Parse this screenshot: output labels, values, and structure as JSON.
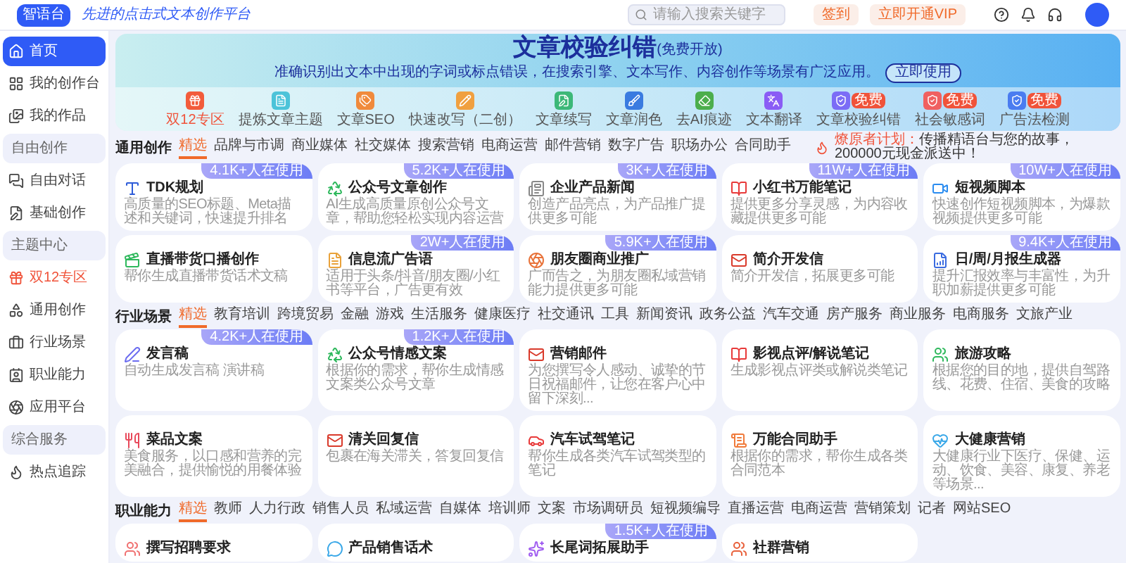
{
  "header": {
    "logo": "智语台",
    "slogan": "先进的点击式文本创作平台",
    "search": {
      "placeholder": "请输入搜索关键字"
    },
    "buttons": [
      {
        "label": "签到"
      },
      {
        "label": "立即开通VIP"
      }
    ]
  },
  "sidebar": {
    "items": [
      {
        "kind": "item",
        "label": "首页",
        "selected": true
      },
      {
        "kind": "item",
        "label": "我的创作台",
        "selected": false
      },
      {
        "kind": "item",
        "label": "我的作品",
        "selected": false
      },
      {
        "kind": "group",
        "label": "自由创作"
      },
      {
        "kind": "item",
        "label": "自由对话",
        "selected": false
      },
      {
        "kind": "item",
        "label": "基础创作",
        "selected": false
      },
      {
        "kind": "group",
        "label": "主题中心"
      },
      {
        "kind": "promo",
        "label": "双12专区",
        "selected": false
      },
      {
        "kind": "item",
        "label": "通用创作",
        "selected": false
      },
      {
        "kind": "item",
        "label": "行业场景",
        "selected": false
      },
      {
        "kind": "item",
        "label": "职业能力",
        "selected": false
      },
      {
        "kind": "item",
        "label": "应用平台",
        "selected": false
      },
      {
        "kind": "group",
        "label": "综合服务"
      },
      {
        "kind": "item",
        "label": "热点追踪",
        "selected": false
      }
    ]
  },
  "banner": {
    "title": "文章校验纠错",
    "title_note": "(免费开放)",
    "subtitle": "准确识别出文本中出现的字词或标点错误，在搜索引擎、文本写作、内容创作等场景有广泛应用。",
    "button": "立即使用",
    "tools": [
      {
        "label": "双12专区",
        "selected": true
      },
      {
        "label": "提炼文章主题",
        "selected": false
      },
      {
        "label": "文章SEO",
        "selected": false
      },
      {
        "label": "快速改写（二创）",
        "selected": false
      },
      {
        "label": "文章续写",
        "selected": false
      },
      {
        "label": "文章润色",
        "selected": false
      },
      {
        "label": "去AI痕迹",
        "selected": false
      },
      {
        "label": "文本翻译",
        "selected": false
      },
      {
        "label": "文章校验纠错",
        "selected": false,
        "badge": "免费"
      },
      {
        "label": "社会敏感词",
        "selected": false,
        "badge": "免费"
      },
      {
        "label": "广告法检测",
        "selected": false,
        "badge": "免费"
      }
    ]
  },
  "sections": [
    {
      "title": "通用创作",
      "tabs": [
        {
          "label": "精选",
          "selected": true
        },
        {
          "label": "品牌与市调",
          "selected": false
        },
        {
          "label": "商业媒体",
          "selected": false
        },
        {
          "label": "社交媒体",
          "selected": false
        },
        {
          "label": "搜索营销",
          "selected": false
        },
        {
          "label": "电商运营",
          "selected": false
        },
        {
          "label": "邮件营销",
          "selected": false
        },
        {
          "label": "数字广告",
          "selected": false
        },
        {
          "label": "职场办公",
          "selected": false
        },
        {
          "label": "合同助手",
          "selected": false
        }
      ],
      "notice": {
        "lead": "燎原者计划：",
        "text": "传播精语台与您的故事，200000元现金派送中！"
      },
      "cards": [
        {
          "title": "TDK规划",
          "description": "高质量的SEO标题、Meta描述和关键词，快速提升排名",
          "badge": "4.1K+人在使用"
        },
        {
          "title": "公众号文章创作",
          "description": "AI生成高质量原创公众号文章，帮助您轻松实现内容运营",
          "badge": "5.2K+人在使用"
        },
        {
          "title": "企业产品新闻",
          "description": "创造产品亮点，为产品推广提供更多可能",
          "badge": "3K+人在使用"
        },
        {
          "title": "小红书万能笔记",
          "description": "提供更多分享灵感，为内容收藏提供更多可能",
          "badge": "11W+人在使用"
        },
        {
          "title": "短视频脚本",
          "description": "快速创作短视频脚本，为爆款视频提供更多可能",
          "badge": "10W+人在使用"
        },
        {
          "title": "直播带货口播创作",
          "description": "帮你生成直播带货话术文稿"
        },
        {
          "title": "信息流广告语",
          "description": "适用于头条/抖音/朋友圈/小红书等平台，广告更有效",
          "badge": "2W+人在使用"
        },
        {
          "title": "朋友圈商业推广",
          "description": "广而告之，为朋友圈私域营销能力提供更多可能",
          "badge": "5.9K+人在使用"
        },
        {
          "title": "简介开发信",
          "description": "简介开发信，拓展更多可能"
        },
        {
          "title": "日/周/月报生成器",
          "description": "提升汇报效率与丰富性，为升职加薪提供更多可能",
          "badge": "9.4K+人在使用"
        }
      ]
    },
    {
      "title": "行业场景",
      "tabs": [
        {
          "label": "精选",
          "selected": true
        },
        {
          "label": "教育培训",
          "selected": false
        },
        {
          "label": "跨境贸易",
          "selected": false
        },
        {
          "label": "金融",
          "selected": false
        },
        {
          "label": "游戏",
          "selected": false
        },
        {
          "label": "生活服务",
          "selected": false
        },
        {
          "label": "健康医疗",
          "selected": false
        },
        {
          "label": "社交通讯",
          "selected": false
        },
        {
          "label": "工具",
          "selected": false
        },
        {
          "label": "新闻资讯",
          "selected": false
        },
        {
          "label": "政务公益",
          "selected": false
        },
        {
          "label": "汽车交通",
          "selected": false
        },
        {
          "label": "房产服务",
          "selected": false
        },
        {
          "label": "商业服务",
          "selected": false
        },
        {
          "label": "电商服务",
          "selected": false
        },
        {
          "label": "文旅产业",
          "selected": false
        }
      ],
      "cards": [
        {
          "title": "发言稿",
          "description": "自动生成发言稿 演讲稿",
          "badge": "4.2K+人在使用"
        },
        {
          "title": "公众号情感文案",
          "description": "根据你的需求，帮你生成情感文案类公众号文章",
          "badge": "1.2K+人在使用"
        },
        {
          "title": "营销邮件",
          "description": "为您撰写令人感动、诚挚的节日祝福邮件，让您在客户心中留下深刻..."
        },
        {
          "title": "影视点评/解说笔记",
          "description": "生成影视点评类或解说类笔记"
        },
        {
          "title": "旅游攻略",
          "description": "根据您的目的地，提供自驾路线、花费、住宿、美食的攻略"
        },
        {
          "title": "菜品文案",
          "description": "美食服务，以口感和营养的完美融合，提供愉悦的用餐体验"
        },
        {
          "title": "清关回复信",
          "description": "包裹在海关滞关，答复回复信"
        },
        {
          "title": "汽车试驾笔记",
          "description": "帮你生成各类汽车试驾类型的笔记"
        },
        {
          "title": "万能合同助手",
          "description": "根据你的需求，帮你生成各类合同范本"
        },
        {
          "title": "大健康营销",
          "description": "大健康行业下医疗、保健、运动、饮食、美容、康复、养老等场景..."
        }
      ]
    },
    {
      "title": "职业能力",
      "tabs": [
        {
          "label": "精选",
          "selected": true
        },
        {
          "label": "教师",
          "selected": false
        },
        {
          "label": "人力行政",
          "selected": false
        },
        {
          "label": "销售人员",
          "selected": false
        },
        {
          "label": "私域运营",
          "selected": false
        },
        {
          "label": "自媒体",
          "selected": false
        },
        {
          "label": "培训师",
          "selected": false
        },
        {
          "label": "文案",
          "selected": false
        },
        {
          "label": "市场调研员",
          "selected": false
        },
        {
          "label": "短视频编导",
          "selected": false
        },
        {
          "label": "直播运营",
          "selected": false
        },
        {
          "label": "电商运营",
          "selected": false
        },
        {
          "label": "营销策划",
          "selected": false
        },
        {
          "label": "记者",
          "selected": false
        },
        {
          "label": "网站SEO",
          "selected": false
        }
      ],
      "cards": [
        {
          "title": "撰写招聘要求"
        },
        {
          "title": "产品销售话术"
        },
        {
          "title": "长尾词拓展助手",
          "badge": "1.5K+人在使用"
        },
        {
          "title": "社群营销"
        }
      ]
    }
  ]
}
